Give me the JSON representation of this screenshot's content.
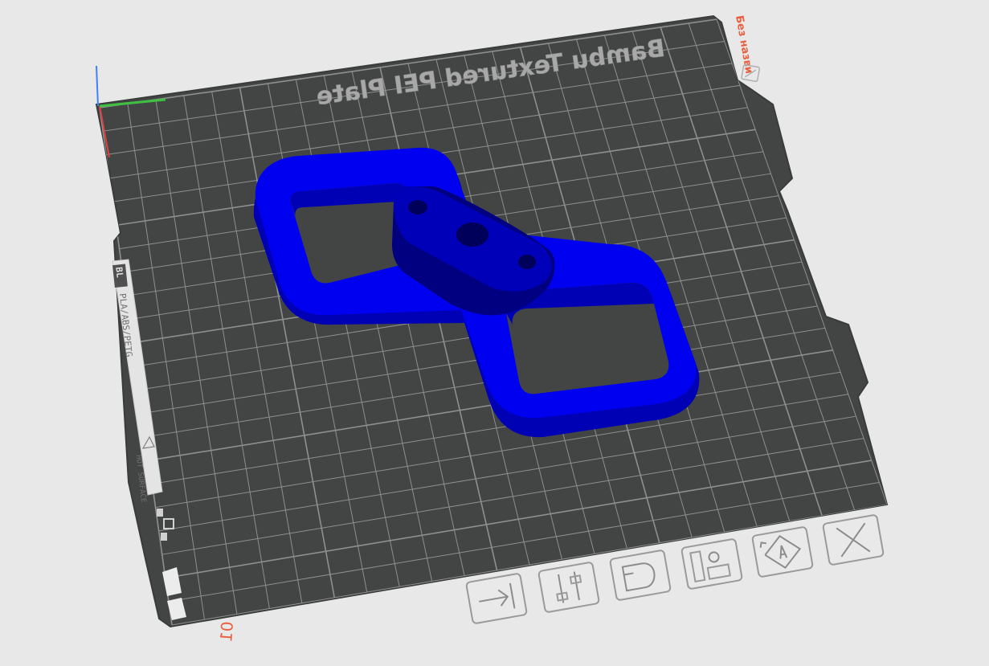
{
  "plate": {
    "name": "Bambu Textured PEI Plate",
    "number": "01",
    "project_name": "Без назви",
    "bed_color": "#434545",
    "grid_color": "#8e9090",
    "background_color": "#e8e8e8"
  },
  "plate_label": {
    "filaments": "PLA/ABS/PETG",
    "warning": "HOT SURFACE",
    "logo_text": "BL"
  },
  "model": {
    "color": "#0000f0",
    "shadow_color": "#0000b4",
    "dark_color": "#000080"
  },
  "axes": {
    "x_color": "#e04040",
    "y_color": "#40c040",
    "z_color": "#4080ff"
  },
  "plate_buttons": [
    {
      "name": "arrange",
      "icon": "arrange-icon"
    },
    {
      "name": "settings",
      "icon": "sliders-icon"
    },
    {
      "name": "lock",
      "icon": "lock-icon"
    },
    {
      "name": "auto-orient",
      "icon": "orient-icon"
    },
    {
      "name": "plate-type",
      "icon": "plate-icon"
    },
    {
      "name": "delete",
      "icon": "close-icon"
    }
  ]
}
